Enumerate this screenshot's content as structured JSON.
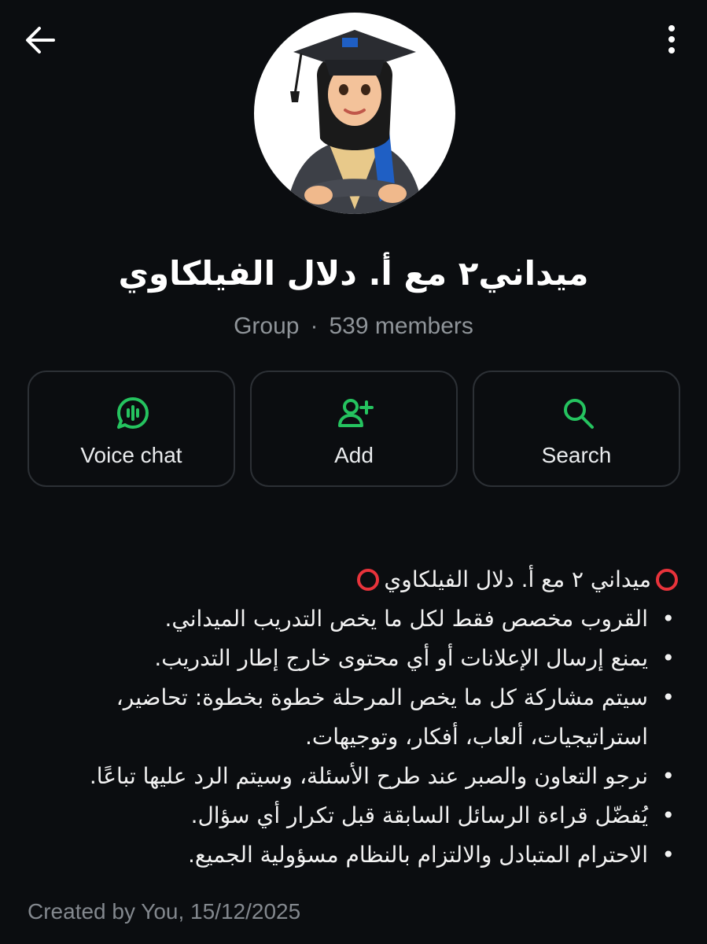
{
  "header": {
    "back_icon": "arrow-left-icon",
    "more_icon": "more-vertical-icon"
  },
  "group": {
    "title": "ميداني٢ مع أ. دلال الفيلكاوي",
    "type": "Group",
    "separator": "·",
    "members": "539 members"
  },
  "actions": [
    {
      "label": "Voice chat",
      "icon": "voice-chat-icon"
    },
    {
      "label": "Add",
      "icon": "add-member-icon"
    },
    {
      "label": "Search",
      "icon": "search-icon"
    }
  ],
  "description": {
    "heading": "ميداني ٢ مع أ. دلال الفيلكاوي",
    "rules": [
      "القروب مخصص فقط لكل ما يخص التدريب الميداني.",
      "يمنع إرسال الإعلانات أو أي محتوى خارج إطار التدريب.",
      "سيتم مشاركة كل ما يخص المرحلة خطوة بخطوة: تحاضير، استراتيجيات، ألعاب، أفكار، وتوجيهات.",
      "نرجو التعاون والصبر عند طرح الأسئلة، وسيتم الرد عليها تباعًا.",
      "يُفضّل قراءة الرسائل السابقة قبل تكرار أي سؤال.",
      "الاحترام المتبادل والالتزام بالنظام مسؤولية الجميع."
    ]
  },
  "created": "Created by You, 15/12/2025",
  "colors": {
    "background": "#0b0d10",
    "accent": "#25c35f",
    "muted_text": "#8f9499",
    "ring": "#e8333b"
  }
}
